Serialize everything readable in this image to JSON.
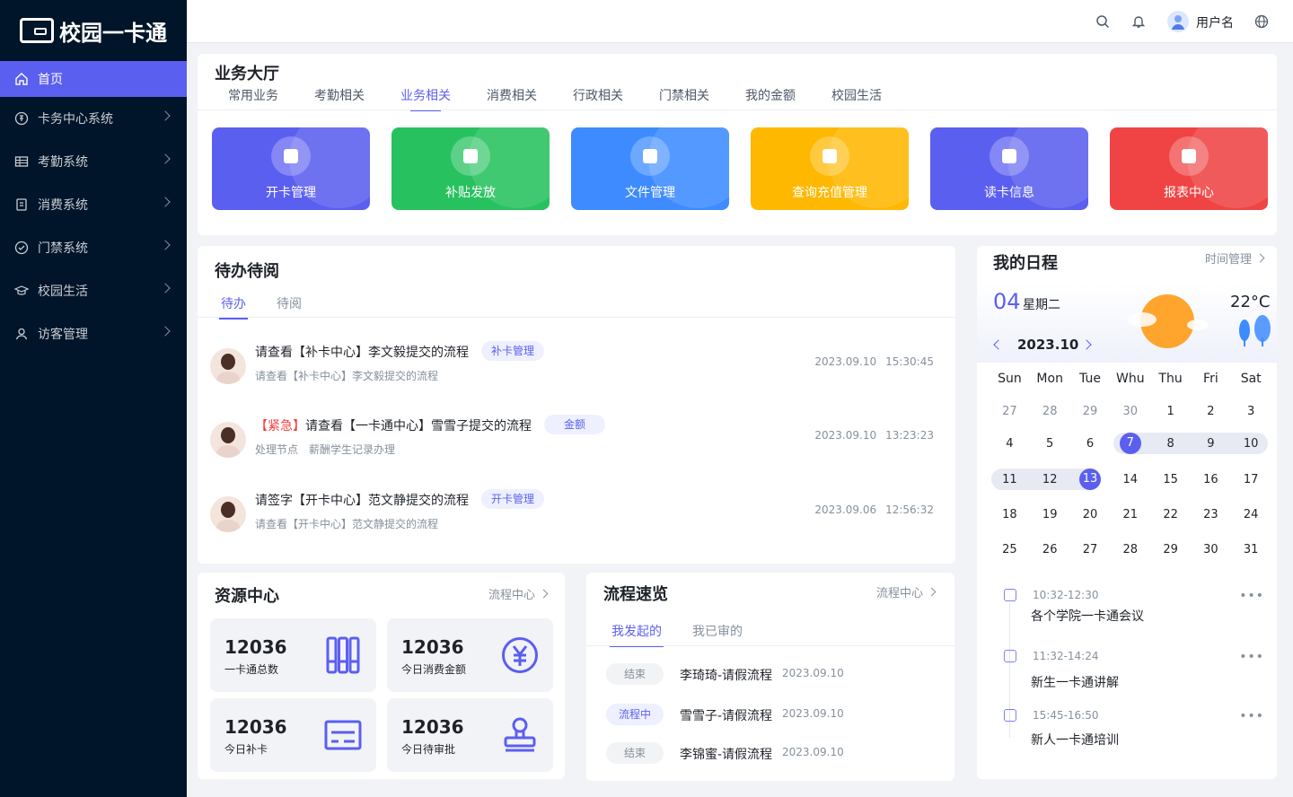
{
  "app": {
    "title": "校园一卡通"
  },
  "sidebar": {
    "items": [
      {
        "label": "首页",
        "icon": "home-icon",
        "active": true
      },
      {
        "label": "卡务中心系统",
        "icon": "card-center-icon"
      },
      {
        "label": "考勤系统",
        "icon": "attendance-icon"
      },
      {
        "label": "消费系统",
        "icon": "consumption-icon"
      },
      {
        "label": "门禁系统",
        "icon": "access-control-icon"
      },
      {
        "label": "校园生活",
        "icon": "campus-life-icon"
      },
      {
        "label": "访客管理",
        "icon": "visitor-icon"
      }
    ]
  },
  "topbar": {
    "username": "用户名"
  },
  "hall": {
    "title": "业务大厅",
    "tabs": [
      "常用业务",
      "考勤相关",
      "业务相关",
      "消费相关",
      "行政相关",
      "门禁相关",
      "我的金额",
      "校园生活"
    ],
    "active_tab": "业务相关",
    "tiles": [
      {
        "label": "开卡管理",
        "color": "#5b5ff0"
      },
      {
        "label": "补贴发放",
        "color": "#27c25f"
      },
      {
        "label": "文件管理",
        "color": "#3d8bff"
      },
      {
        "label": "查询充值管理",
        "color": "#ffb800"
      },
      {
        "label": "读卡信息",
        "color": "#5b5ff0"
      },
      {
        "label": "报表中心",
        "color": "#f04444"
      }
    ]
  },
  "todo": {
    "title": "待办待阅",
    "tabs": [
      "待办",
      "待阅"
    ],
    "items": [
      {
        "prefix": "",
        "title": "请查看【补卡中心】李文毅提交的流程",
        "badge": "补卡管理",
        "sub": [
          "请查看【补卡中心】李文毅提交的流程"
        ],
        "date": "2023.09.10",
        "time": "15:30:45"
      },
      {
        "prefix": "【紧急】",
        "title": "请查看【一卡通中心】雪雪子提交的流程",
        "badge": "金额",
        "sub": [
          "处理节点",
          "薪酬学生记录办理"
        ],
        "date": "2023.09.10",
        "time": "13:23:23"
      },
      {
        "prefix": "",
        "title": "请签字【开卡中心】范文静提交的流程",
        "badge": "开卡管理",
        "sub": [
          "请查看【开卡中心】范文静提交的流程"
        ],
        "date": "2023.09.06",
        "time": "12:56:32"
      }
    ]
  },
  "schedule": {
    "title": "我的日程",
    "more": "时间管理",
    "day": "04",
    "weekday": "星期二",
    "temperature": "22°C",
    "month": "2023.10",
    "weekdays": [
      "Sun",
      "Mon",
      "Tue",
      "Whu",
      "Thu",
      "Fri",
      "Sat"
    ],
    "weeks": [
      [
        "27",
        "28",
        "29",
        "30",
        "1",
        "2",
        "3"
      ],
      [
        "4",
        "5",
        "6",
        "7",
        "8",
        "9",
        "10"
      ],
      [
        "11",
        "12",
        "13",
        "14",
        "15",
        "16",
        "17"
      ],
      [
        "18",
        "19",
        "20",
        "21",
        "22",
        "23",
        "24"
      ],
      [
        "25",
        "26",
        "27",
        "28",
        "29",
        "30",
        "31"
      ]
    ],
    "events": [
      {
        "time": "10:32-12:30",
        "title": "各个学院一卡通会议"
      },
      {
        "time": "11:32-14:24",
        "title": "新生一卡通讲解"
      },
      {
        "time": "15:45-16:50",
        "title": "新人一卡通培训"
      }
    ]
  },
  "resource": {
    "title": "资源中心",
    "more": "流程中心",
    "stats": [
      {
        "value": "12036",
        "label": "一卡通总数",
        "icon": "books-icon"
      },
      {
        "value": "12036",
        "label": "今日消费金额",
        "icon": "yuan-icon"
      },
      {
        "value": "12036",
        "label": "今日补卡",
        "icon": "card-icon"
      },
      {
        "value": "12036",
        "label": "今日待审批",
        "icon": "stamp-icon"
      }
    ]
  },
  "flow": {
    "title": "流程速览",
    "more": "流程中心",
    "tabs": [
      "我发起的",
      "我已审的"
    ],
    "items": [
      {
        "status": "结束",
        "state": "done",
        "name": "李琦琦-请假流程",
        "date": "2023.09.10"
      },
      {
        "status": "流程中",
        "state": "running",
        "name": "雪雪子-请假流程",
        "date": "2023.09.10"
      },
      {
        "status": "结束",
        "state": "done",
        "name": "李锦蜜-请假流程",
        "date": "2023.09.10"
      }
    ]
  }
}
